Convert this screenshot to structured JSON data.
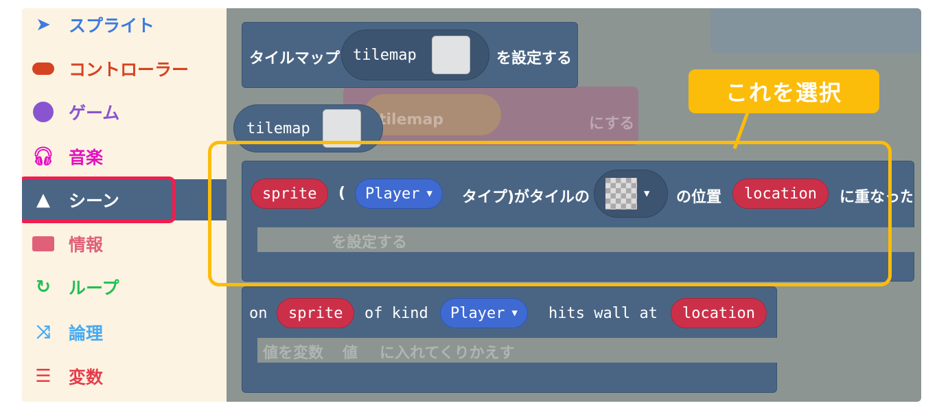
{
  "sidebar": {
    "items": [
      {
        "label": "スプライト",
        "icon": "paper-plane-icon",
        "color": "#3d7be0"
      },
      {
        "label": "コントローラー",
        "icon": "gamepad-icon",
        "color": "#d54322"
      },
      {
        "label": "ゲーム",
        "icon": "circle-icon",
        "color": "#8854d0"
      },
      {
        "label": "音楽",
        "icon": "headphones-icon",
        "color": "#e30fc0"
      },
      {
        "label": "シーン",
        "icon": "tree-icon",
        "color": "#4b6584",
        "selected": true
      },
      {
        "label": "情報",
        "icon": "id-card-icon",
        "color": "#e0607a"
      },
      {
        "label": "ループ",
        "icon": "loop-icon",
        "color": "#20bf55"
      },
      {
        "label": "論理",
        "icon": "shuffle-icon",
        "color": "#45aaf2"
      },
      {
        "label": "変数",
        "icon": "list-icon",
        "color": "#e63c4a"
      }
    ]
  },
  "blocks": {
    "set_tilemap": {
      "prefix": "タイルマップ",
      "value": "tilemap",
      "suffix": "を設定する"
    },
    "tilemap_reporter": {
      "value": "tilemap"
    },
    "ghost_tilemap": {
      "value": "tilemap",
      "suffix": "にする"
    },
    "overlap_event": {
      "sprite": "sprite",
      "paren": "(",
      "kind": "Player",
      "text1": "タイプ)がタイルの",
      "text2": "の位置",
      "location": "location",
      "text3": "に重なった時"
    },
    "ghost_inner1": {
      "text": "を設定する"
    },
    "wall_event": {
      "on": "on",
      "sprite": "sprite",
      "of_kind": "of kind",
      "kind": "Player",
      "hits": "hits wall at",
      "location": "location"
    },
    "ghost_inner2": {
      "text1": "値を変数",
      "text2": "値",
      "text3": "に入れてくりかえす"
    }
  },
  "callout": {
    "text": "これを選択",
    "color": "#fcbc0a"
  }
}
